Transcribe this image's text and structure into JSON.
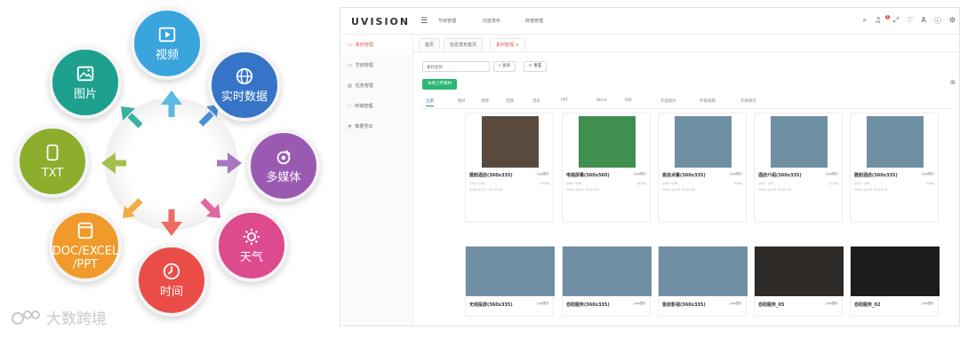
{
  "diagram": {
    "petals": {
      "video": "视频",
      "realtime": "实时数据",
      "media": "多媒体",
      "weather": "天气",
      "time": "时间",
      "doc": "DOC/EXCEL\n/PPT",
      "txt": "TXT",
      "image": "图片"
    },
    "watermark": "大数跨境",
    "colors": {
      "video": "#3aa4dc",
      "realtime": "#3674c8",
      "media": "#9b5ab2",
      "weather": "#dd4a8d",
      "time": "#ea4d48",
      "doc": "#ef9a2a",
      "txt": "#8cae2c",
      "image": "#1ea08f"
    }
  },
  "app": {
    "logo": "UVISION",
    "topnav": [
      "节目管理",
      "内容发布",
      "终端管理"
    ],
    "sidebar": [
      "素材管理",
      "节目管理",
      "任务管理",
      "终端管理",
      "数据导出"
    ],
    "tabs": [
      "首页",
      "信息发布首页",
      "素材管理"
    ],
    "search": {
      "placeholder": "素材名称",
      "search_label": "查询",
      "reset_label": "重置"
    },
    "add_label": "本地上传素材",
    "categories": [
      "全部",
      "图片",
      "视频",
      "音频",
      "音乐",
      "PPT",
      "Word",
      "PDF",
      "外链图片",
      "外链视频",
      "外链网页"
    ],
    "cards_row1": [
      {
        "title": "雅韵酒店(360x335)",
        "type": "jpg/图片",
        "dim": "256 * 236",
        "size": "101kb",
        "date": "2022-10-07 10:20:44"
      },
      {
        "title": "电视屏幕(360x560)",
        "type": "jpg/图片",
        "dim": "256 * 398",
        "size": "143kb",
        "date": "2022-10-07 10:21:57"
      },
      {
        "title": "客房点餐(360x335)",
        "type": "jpg/图片",
        "dim": "256 * 236",
        "size": "89kb",
        "date": "2022-10-07 10:22:08"
      },
      {
        "title": "酒店介绍(360x335)",
        "type": "jpg/图片",
        "dim": "256 * 236",
        "size": "112kb",
        "date": "2022-10-07 10:22:35"
      },
      {
        "title": "雅韵酒店(360x335)",
        "type": "jpg/图片",
        "dim": "256 * 236",
        "size": "95kb",
        "date": "2022-10-07 10:23:10"
      }
    ],
    "cards_row2": [
      {
        "title": "无线投屏(360x335)",
        "type": "jpg/图片"
      },
      {
        "title": "自助服务(360x335)",
        "type": "jpg/图片"
      },
      {
        "title": "客房影视(360x335)",
        "type": "jpg/图片"
      },
      {
        "title": "自助服务_05",
        "type": "jpg/图片"
      },
      {
        "title": "自助服务_02",
        "type": "jpg/图片"
      }
    ]
  }
}
